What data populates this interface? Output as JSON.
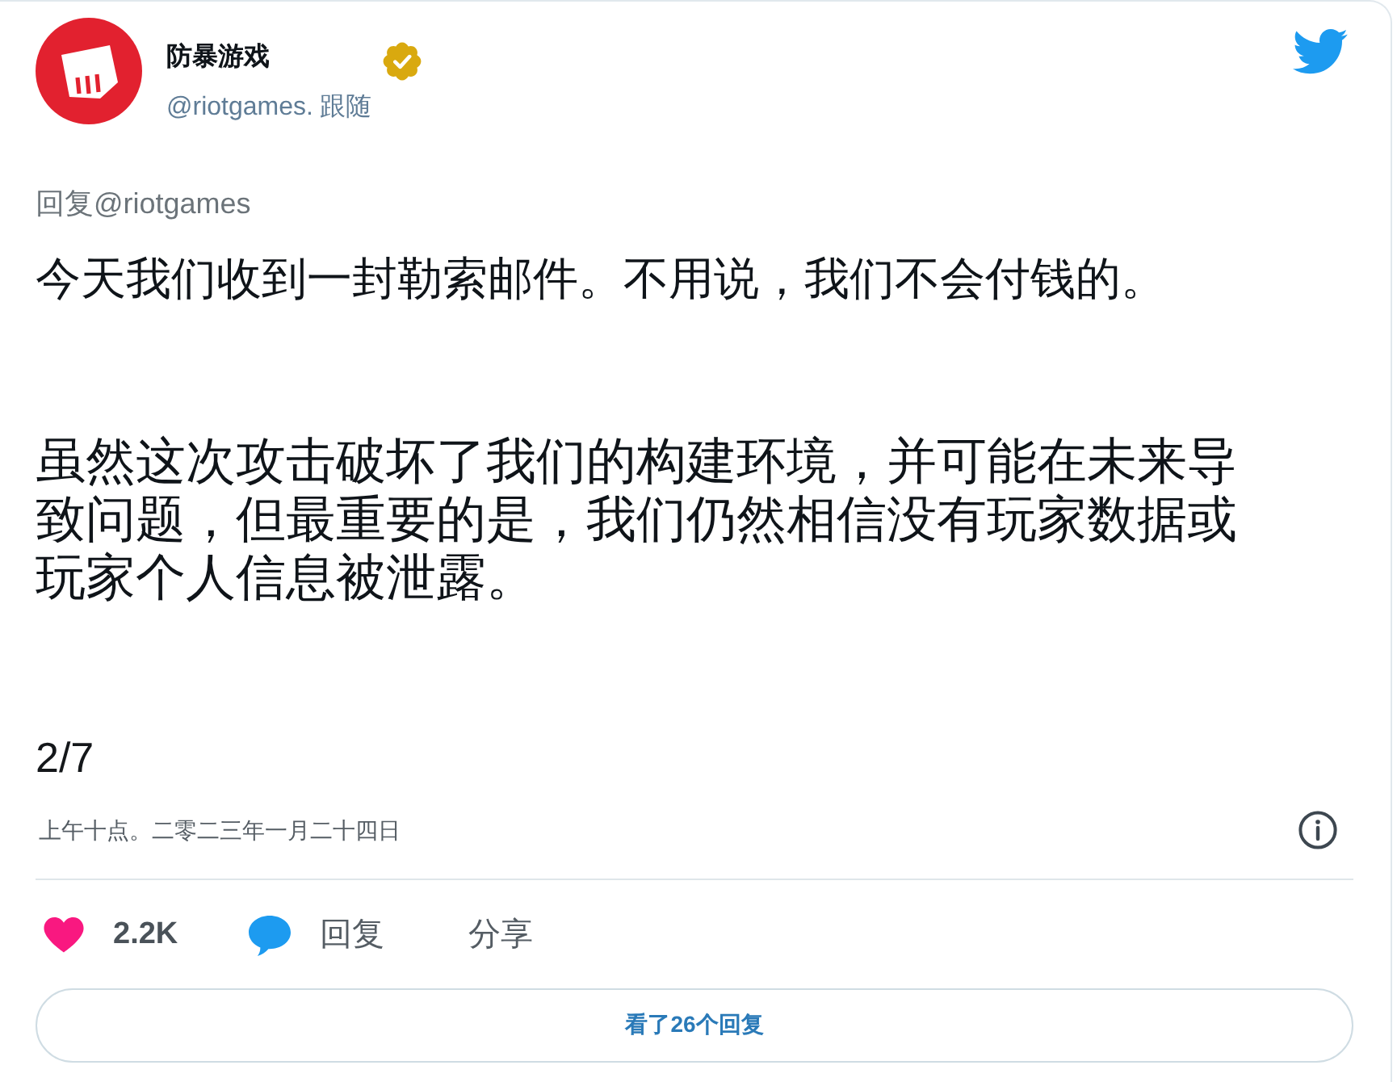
{
  "account": {
    "name": "防暴游戏",
    "verified": true,
    "handle": "@riotgames.",
    "follow": "跟随"
  },
  "reply_to": "回复@riotgames",
  "paragraphs": [
    "今天我们收到一封勒索邮件。不用说，我们不会付钱的。",
    "虽然这次攻击破坏了我们的构建环境，并可能在未来导致问题，但最重要的是，我们仍然相信没有玩家数据或玩家个人信息被泄露。"
  ],
  "thread_position": "2/7",
  "timestamp": "上午十点。二零二三年一月二十四日",
  "actions": [
    {
      "kind": "like",
      "label": "2.2K"
    },
    {
      "kind": "reply",
      "label": "回复"
    },
    {
      "kind": "share",
      "label": "分享"
    }
  ],
  "replies_button": "看了26个回复"
}
